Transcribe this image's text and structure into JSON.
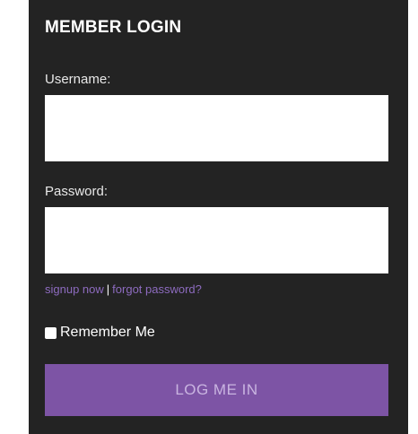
{
  "login": {
    "title": "MEMBER LOGIN",
    "username_label": "Username:",
    "username_value": "",
    "password_label": "Password:",
    "password_value": "",
    "signup_link": "signup now",
    "separator": "|",
    "forgot_link": "forgot password?",
    "remember_label": "Remember Me",
    "remember_checked": false,
    "submit_label": "LOG ME IN"
  },
  "colors": {
    "panel_background": "#232323",
    "accent": "#7d54a5",
    "link": "#8d6bbf"
  }
}
